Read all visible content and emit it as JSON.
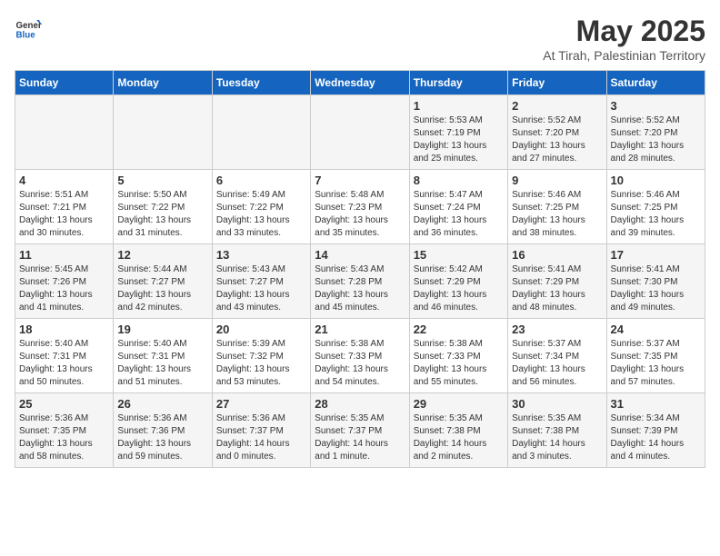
{
  "header": {
    "logo_general": "General",
    "logo_blue": "Blue",
    "title": "May 2025",
    "subtitle": "At Tirah, Palestinian Territory"
  },
  "days_of_week": [
    "Sunday",
    "Monday",
    "Tuesday",
    "Wednesday",
    "Thursday",
    "Friday",
    "Saturday"
  ],
  "weeks": [
    [
      {
        "day": "",
        "info": ""
      },
      {
        "day": "",
        "info": ""
      },
      {
        "day": "",
        "info": ""
      },
      {
        "day": "",
        "info": ""
      },
      {
        "day": "1",
        "info": "Sunrise: 5:53 AM\nSunset: 7:19 PM\nDaylight: 13 hours\nand 25 minutes."
      },
      {
        "day": "2",
        "info": "Sunrise: 5:52 AM\nSunset: 7:20 PM\nDaylight: 13 hours\nand 27 minutes."
      },
      {
        "day": "3",
        "info": "Sunrise: 5:52 AM\nSunset: 7:20 PM\nDaylight: 13 hours\nand 28 minutes."
      }
    ],
    [
      {
        "day": "4",
        "info": "Sunrise: 5:51 AM\nSunset: 7:21 PM\nDaylight: 13 hours\nand 30 minutes."
      },
      {
        "day": "5",
        "info": "Sunrise: 5:50 AM\nSunset: 7:22 PM\nDaylight: 13 hours\nand 31 minutes."
      },
      {
        "day": "6",
        "info": "Sunrise: 5:49 AM\nSunset: 7:22 PM\nDaylight: 13 hours\nand 33 minutes."
      },
      {
        "day": "7",
        "info": "Sunrise: 5:48 AM\nSunset: 7:23 PM\nDaylight: 13 hours\nand 35 minutes."
      },
      {
        "day": "8",
        "info": "Sunrise: 5:47 AM\nSunset: 7:24 PM\nDaylight: 13 hours\nand 36 minutes."
      },
      {
        "day": "9",
        "info": "Sunrise: 5:46 AM\nSunset: 7:25 PM\nDaylight: 13 hours\nand 38 minutes."
      },
      {
        "day": "10",
        "info": "Sunrise: 5:46 AM\nSunset: 7:25 PM\nDaylight: 13 hours\nand 39 minutes."
      }
    ],
    [
      {
        "day": "11",
        "info": "Sunrise: 5:45 AM\nSunset: 7:26 PM\nDaylight: 13 hours\nand 41 minutes."
      },
      {
        "day": "12",
        "info": "Sunrise: 5:44 AM\nSunset: 7:27 PM\nDaylight: 13 hours\nand 42 minutes."
      },
      {
        "day": "13",
        "info": "Sunrise: 5:43 AM\nSunset: 7:27 PM\nDaylight: 13 hours\nand 43 minutes."
      },
      {
        "day": "14",
        "info": "Sunrise: 5:43 AM\nSunset: 7:28 PM\nDaylight: 13 hours\nand 45 minutes."
      },
      {
        "day": "15",
        "info": "Sunrise: 5:42 AM\nSunset: 7:29 PM\nDaylight: 13 hours\nand 46 minutes."
      },
      {
        "day": "16",
        "info": "Sunrise: 5:41 AM\nSunset: 7:29 PM\nDaylight: 13 hours\nand 48 minutes."
      },
      {
        "day": "17",
        "info": "Sunrise: 5:41 AM\nSunset: 7:30 PM\nDaylight: 13 hours\nand 49 minutes."
      }
    ],
    [
      {
        "day": "18",
        "info": "Sunrise: 5:40 AM\nSunset: 7:31 PM\nDaylight: 13 hours\nand 50 minutes."
      },
      {
        "day": "19",
        "info": "Sunrise: 5:40 AM\nSunset: 7:31 PM\nDaylight: 13 hours\nand 51 minutes."
      },
      {
        "day": "20",
        "info": "Sunrise: 5:39 AM\nSunset: 7:32 PM\nDaylight: 13 hours\nand 53 minutes."
      },
      {
        "day": "21",
        "info": "Sunrise: 5:38 AM\nSunset: 7:33 PM\nDaylight: 13 hours\nand 54 minutes."
      },
      {
        "day": "22",
        "info": "Sunrise: 5:38 AM\nSunset: 7:33 PM\nDaylight: 13 hours\nand 55 minutes."
      },
      {
        "day": "23",
        "info": "Sunrise: 5:37 AM\nSunset: 7:34 PM\nDaylight: 13 hours\nand 56 minutes."
      },
      {
        "day": "24",
        "info": "Sunrise: 5:37 AM\nSunset: 7:35 PM\nDaylight: 13 hours\nand 57 minutes."
      }
    ],
    [
      {
        "day": "25",
        "info": "Sunrise: 5:36 AM\nSunset: 7:35 PM\nDaylight: 13 hours\nand 58 minutes."
      },
      {
        "day": "26",
        "info": "Sunrise: 5:36 AM\nSunset: 7:36 PM\nDaylight: 13 hours\nand 59 minutes."
      },
      {
        "day": "27",
        "info": "Sunrise: 5:36 AM\nSunset: 7:37 PM\nDaylight: 14 hours\nand 0 minutes."
      },
      {
        "day": "28",
        "info": "Sunrise: 5:35 AM\nSunset: 7:37 PM\nDaylight: 14 hours\nand 1 minute."
      },
      {
        "day": "29",
        "info": "Sunrise: 5:35 AM\nSunset: 7:38 PM\nDaylight: 14 hours\nand 2 minutes."
      },
      {
        "day": "30",
        "info": "Sunrise: 5:35 AM\nSunset: 7:38 PM\nDaylight: 14 hours\nand 3 minutes."
      },
      {
        "day": "31",
        "info": "Sunrise: 5:34 AM\nSunset: 7:39 PM\nDaylight: 14 hours\nand 4 minutes."
      }
    ]
  ]
}
